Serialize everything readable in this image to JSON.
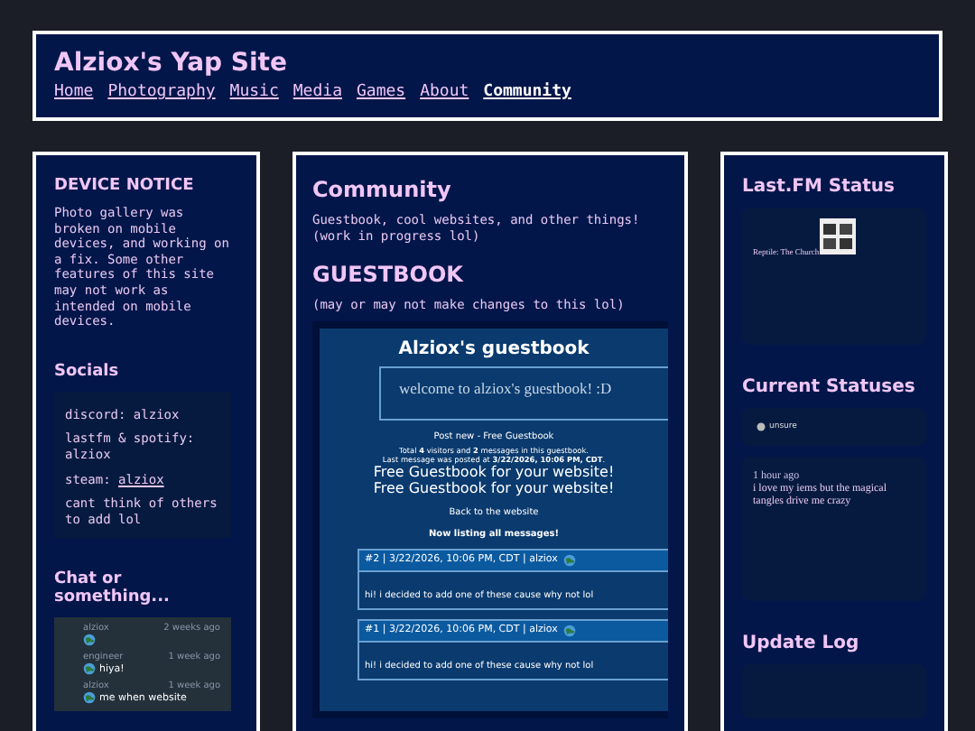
{
  "header": {
    "title": "Alziox's Yap Site",
    "nav": [
      {
        "label": "Home",
        "selected": false
      },
      {
        "label": "Photography",
        "selected": false
      },
      {
        "label": "Music",
        "selected": false
      },
      {
        "label": "Media",
        "selected": false
      },
      {
        "label": "Games",
        "selected": false
      },
      {
        "label": "About",
        "selected": false
      },
      {
        "label": "Community",
        "selected": true
      }
    ]
  },
  "left": {
    "notice_title": "DEVICE NOTICE",
    "notice_text": "Photo gallery was broken on mobile devices, and working on a fix. Some other features of this site may not work as intended on mobile devices.",
    "socials_title": "Socials",
    "socials": [
      {
        "kind": "text",
        "text": "discord: alziox"
      },
      {
        "kind": "text",
        "text": "lastfm & spotify: alziox"
      },
      {
        "kind": "link",
        "text": "steam: ",
        "link": "alziox"
      },
      {
        "kind": "text",
        "text": "cant think of others to add lol"
      }
    ],
    "chat_title": "Chat or something...",
    "chat": [
      {
        "user": "alziox",
        "time": "2 weeks ago"
      },
      {
        "user": "engineer",
        "time": "1 week ago",
        "message": "hiya!"
      },
      {
        "user": "alziox",
        "time": "1 week ago",
        "message": "me when website"
      }
    ]
  },
  "main": {
    "title": "Community",
    "intro": "Guestbook, cool websites, and other things! (work in progress lol)",
    "guestbook_title": "GUESTBOOK",
    "guestbook_note": "(may or may not make changes to this lol)",
    "guestbook": {
      "title": "Alziox's guestbook",
      "welcome": "welcome to alziox's guestbook! :D",
      "post_link": "Post new - Free Guestbook",
      "stats": "Total **4** visitors and **2** messages in this guestbook.",
      "last": "Last message was posted at **3/22/2026, 10:06 PM, CDT**.",
      "promo": [
        "Free Guestbook for your website!",
        "Free Guestbook for your website!"
      ],
      "back": "Back to the website",
      "listing": "Now listing all messages!",
      "entries": [
        {
          "header": "#2 | 3/22/2026, 10:06 PM, CDT | alziox",
          "text": "hi! i decided to add one of these cause why not lol"
        },
        {
          "header": "#1 | 3/22/2026, 10:06 PM, CDT | alziox",
          "text": "hi! i decided to add one of these cause why not lol"
        }
      ]
    }
  },
  "right": {
    "lastfm_title": "Last.FM Status",
    "track": "Reptile: The Church",
    "statuses_title": "Current Statuses",
    "status_tag": "unsure",
    "status_time": "1 hour ago",
    "status_text": "i love my iems but the magical tangles drive me crazy",
    "update_title": "Update Log"
  }
}
